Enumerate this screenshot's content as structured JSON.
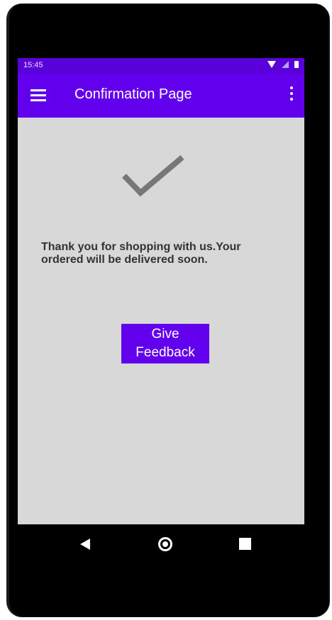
{
  "status_bar": {
    "time": "15:45",
    "icons": [
      "wifi-icon",
      "signal-icon",
      "battery-icon"
    ]
  },
  "app_bar": {
    "title": "Confirmation Page",
    "menu_icon": "hamburger-menu-icon",
    "overflow_icon": "more-vert-icon"
  },
  "content": {
    "check_icon": "checkmark-icon",
    "message": "Thank you for shopping with us.Your ordered will be delivered soon.",
    "feedback_button_label": "Give Feedback"
  },
  "nav_bar": {
    "buttons": [
      "back-icon",
      "home-icon",
      "recents-icon"
    ]
  },
  "colors": {
    "primary": "#6200ee",
    "status_bar": "#5a00d8",
    "background": "#d8d8d8",
    "text": "#333333",
    "check": "#777777"
  }
}
